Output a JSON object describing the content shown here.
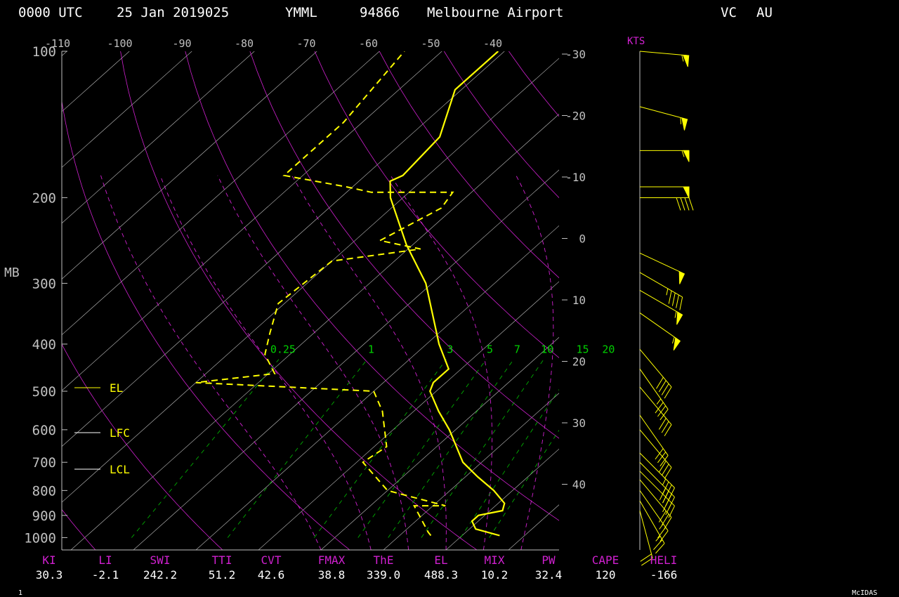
{
  "header": {
    "time": "0000 UTC",
    "date": "25 Jan 2019025",
    "icao": "YMML",
    "wmo_id": "94866",
    "station": "Melbourne Airport",
    "state": "VC",
    "country": "AU"
  },
  "footer": {
    "frame_number": "1",
    "brand": "McIDAS"
  },
  "colors": {
    "frame": "#c0c0c0",
    "isotherm": "#bfbfbf",
    "dry_adiabat": "#d020d0",
    "moist_adiabat": "#d020d0",
    "mixing_ratio": "#00c000",
    "temperature": "#ffff00",
    "dewpoint": "#ffff00",
    "index_label": "#d020d0",
    "index_value": "#ffffff",
    "mix_label": "#00d000"
  },
  "chart_data": {
    "type": "skew-t",
    "ylabel": "MB",
    "wind_unit": "KTS",
    "temperature_ticks": [
      "-110",
      "-100",
      "-90",
      "-80",
      "-70",
      "-60",
      "-50",
      "-40"
    ],
    "pressure_ticks": [
      "100",
      "200",
      "300",
      "400",
      "500",
      "600",
      "700",
      "800",
      "900",
      "1000"
    ],
    "height_ticks": [
      "-30",
      "-20",
      "-10",
      "0",
      "10",
      "20",
      "30",
      "40"
    ],
    "mixing_ratio_labels": [
      "0.25",
      "1",
      "3",
      "5",
      "7",
      "10",
      "15",
      "20"
    ],
    "levels": [
      "EL",
      "LFC",
      "LCL"
    ],
    "temperature_profile": [
      {
        "p": 990,
        "t": 26
      },
      {
        "p": 960,
        "t": 21
      },
      {
        "p": 925,
        "t": 19
      },
      {
        "p": 900,
        "t": 19
      },
      {
        "p": 880,
        "t": 22
      },
      {
        "p": 850,
        "t": 21
      },
      {
        "p": 800,
        "t": 17
      },
      {
        "p": 750,
        "t": 12
      },
      {
        "p": 700,
        "t": 7
      },
      {
        "p": 600,
        "t": -1
      },
      {
        "p": 550,
        "t": -6
      },
      {
        "p": 500,
        "t": -11
      },
      {
        "p": 480,
        "t": -12
      },
      {
        "p": 450,
        "t": -12
      },
      {
        "p": 400,
        "t": -18
      },
      {
        "p": 300,
        "t": -31
      },
      {
        "p": 250,
        "t": -41
      },
      {
        "p": 200,
        "t": -52
      },
      {
        "p": 185,
        "t": -55
      },
      {
        "p": 180,
        "t": -54
      },
      {
        "p": 150,
        "t": -55
      },
      {
        "p": 120,
        "t": -61
      },
      {
        "p": 100,
        "t": -61
      }
    ],
    "dewpoint_profile": [
      {
        "p": 990,
        "t": 15
      },
      {
        "p": 975,
        "t": 14
      },
      {
        "p": 860,
        "t": 7
      },
      {
        "p": 860,
        "t": 12
      },
      {
        "p": 800,
        "t": 0
      },
      {
        "p": 700,
        "t": -9
      },
      {
        "p": 650,
        "t": -8
      },
      {
        "p": 550,
        "t": -15
      },
      {
        "p": 500,
        "t": -20
      },
      {
        "p": 480,
        "t": -50
      },
      {
        "p": 460,
        "t": -39
      },
      {
        "p": 420,
        "t": -44
      },
      {
        "p": 380,
        "t": -47
      },
      {
        "p": 330,
        "t": -51
      },
      {
        "p": 270,
        "t": -50
      },
      {
        "p": 255,
        "t": -38
      },
      {
        "p": 245,
        "t": -46
      },
      {
        "p": 210,
        "t": -42
      },
      {
        "p": 195,
        "t": -43
      },
      {
        "p": 195,
        "t": -56
      },
      {
        "p": 190,
        "t": -61
      },
      {
        "p": 180,
        "t": -73
      },
      {
        "p": 140,
        "t": -73
      },
      {
        "p": 100,
        "t": -76
      }
    ],
    "wind_barbs": [
      {
        "p": 100,
        "dir": 275,
        "spd": 55
      },
      {
        "p": 130,
        "dir": 285,
        "spd": 55
      },
      {
        "p": 160,
        "dir": 270,
        "spd": 55
      },
      {
        "p": 190,
        "dir": 270,
        "spd": 50
      },
      {
        "p": 200,
        "dir": 270,
        "spd": 40
      },
      {
        "p": 260,
        "dir": 295,
        "spd": 50
      },
      {
        "p": 285,
        "dir": 300,
        "spd": 45
      },
      {
        "p": 310,
        "dir": 300,
        "spd": 55
      },
      {
        "p": 345,
        "dir": 305,
        "spd": 55
      },
      {
        "p": 410,
        "dir": 320,
        "spd": 40
      },
      {
        "p": 450,
        "dir": 325,
        "spd": 35
      },
      {
        "p": 490,
        "dir": 320,
        "spd": 30
      },
      {
        "p": 560,
        "dir": 325,
        "spd": 30
      },
      {
        "p": 600,
        "dir": 320,
        "spd": 30
      },
      {
        "p": 670,
        "dir": 315,
        "spd": 35
      },
      {
        "p": 700,
        "dir": 315,
        "spd": 40
      },
      {
        "p": 730,
        "dir": 315,
        "spd": 35
      },
      {
        "p": 760,
        "dir": 320,
        "spd": 30
      },
      {
        "p": 800,
        "dir": 325,
        "spd": 25
      },
      {
        "p": 840,
        "dir": 330,
        "spd": 25
      },
      {
        "p": 880,
        "dir": 345,
        "spd": 20
      }
    ],
    "indices": [
      {
        "label": "KI",
        "value": "30.3"
      },
      {
        "label": "LI",
        "value": "-2.1"
      },
      {
        "label": "SWI",
        "value": "242.2"
      },
      {
        "label": "TTI",
        "value": "51.2"
      },
      {
        "label": "CVT",
        "value": "42.6"
      },
      {
        "label": "FMAX",
        "value": "38.8"
      },
      {
        "label": "ThE",
        "value": "339.0"
      },
      {
        "label": "EL",
        "value": "488.3"
      },
      {
        "label": "MIX",
        "value": "10.2"
      },
      {
        "label": "PW",
        "value": "32.4"
      },
      {
        "label": "CAPE",
        "value": "120"
      },
      {
        "label": "HELI",
        "value": "-166"
      }
    ]
  }
}
